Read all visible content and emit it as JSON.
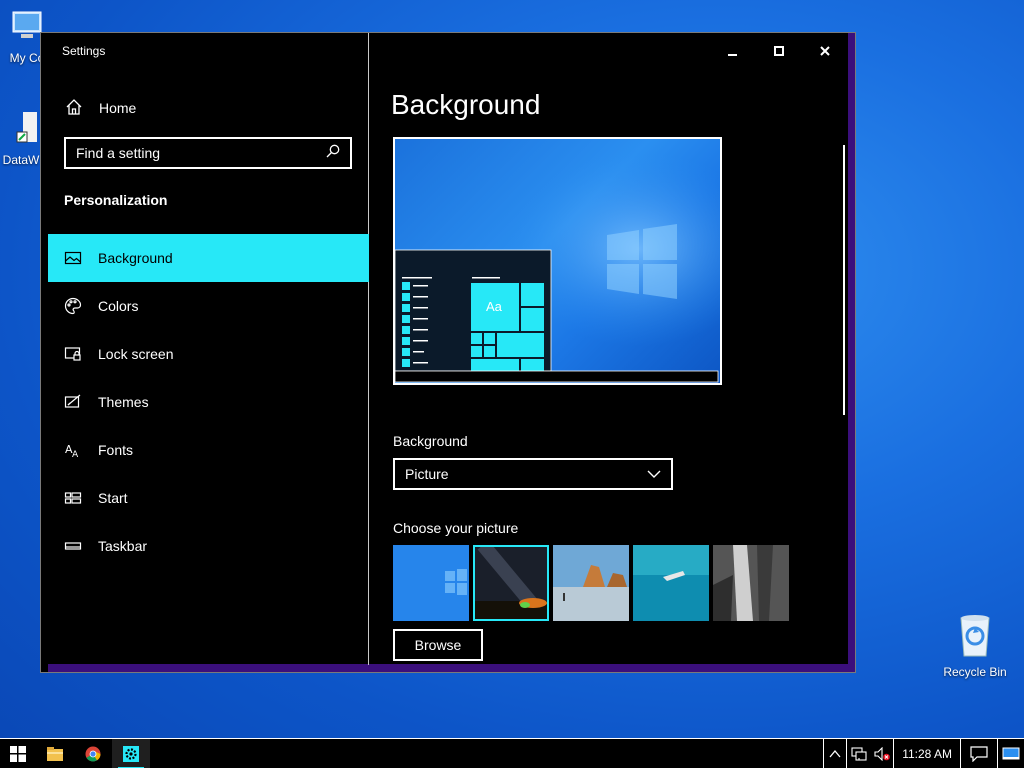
{
  "desktop": {
    "icons": [
      {
        "label": "My Computer",
        "visible_label": "My Co"
      },
      {
        "label": "DataWarrior",
        "visible_label": "DataW"
      },
      {
        "label": "Recycle Bin",
        "visible_label": "Recycle Bin"
      }
    ]
  },
  "window": {
    "title": "Settings",
    "controls": {
      "minimize": "minimize-icon",
      "maximize": "maximize-icon",
      "close": "close-icon"
    }
  },
  "sidebar": {
    "home_label": "Home",
    "search": {
      "placeholder": "Find a setting",
      "value": ""
    },
    "section_heading": "Personalization",
    "items": [
      {
        "label": "Background",
        "icon": "picture-icon",
        "active": true
      },
      {
        "label": "Colors",
        "icon": "palette-icon",
        "active": false
      },
      {
        "label": "Lock screen",
        "icon": "lock-screen-icon",
        "active": false
      },
      {
        "label": "Themes",
        "icon": "themes-icon",
        "active": false
      },
      {
        "label": "Fonts",
        "icon": "fonts-icon",
        "active": false
      },
      {
        "label": "Start",
        "icon": "start-icon",
        "active": false
      },
      {
        "label": "Taskbar",
        "icon": "taskbar-icon",
        "active": false
      }
    ]
  },
  "main": {
    "title": "Background",
    "preview": {
      "tile_text": "Aa"
    },
    "background_label": "Background",
    "background_value": "Picture",
    "choose_label": "Choose your picture",
    "thumbnails": [
      "windows-blue",
      "night-sky",
      "beach-rocks",
      "underwater-swimmer",
      "rock-waterfall"
    ],
    "selected_thumbnail": 1,
    "browse_label": "Browse"
  },
  "taskbar": {
    "apps": [
      "file-explorer-icon",
      "chrome-icon",
      "settings-icon"
    ],
    "active_app": "settings-icon",
    "clock": "11:28 AM"
  },
  "colors": {
    "accent": "#27e8f7",
    "window_frame": "#3b0f7c",
    "desktop": "#1a6fe0"
  }
}
